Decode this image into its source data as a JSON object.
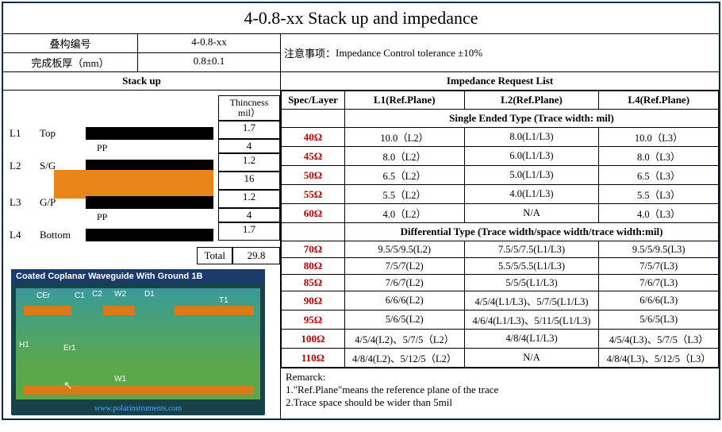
{
  "title": "4-0.8-xx Stack up and impedance",
  "meta": {
    "label1": "叠构编号",
    "val1": "4-0.8-xx",
    "label2": "完成板厚（mm）",
    "val2": "0.8±0.1",
    "note_label": "注意事项：",
    "note_val": "Impedance Control tolerance ±10%"
  },
  "stackup": {
    "title": "Stack  up",
    "thick_hdr1": "Thincness",
    "thick_hdr2": "mil）",
    "layers": [
      {
        "id": "L1",
        "name": "Top",
        "bar": "black",
        "thick": "1.7"
      },
      {
        "id": "",
        "name": "",
        "bar": "",
        "pp": "PP",
        "thick": "4"
      },
      {
        "id": "L2",
        "name": "S/G",
        "bar": "black",
        "thick": "1.2"
      },
      {
        "id": "",
        "name": "",
        "bar": "orange",
        "thick": "16"
      },
      {
        "id": "L3",
        "name": "G/P",
        "bar": "black",
        "thick": "1.2"
      },
      {
        "id": "",
        "name": "",
        "bar": "",
        "pp": "PP",
        "thick": "4"
      },
      {
        "id": "L4",
        "name": "Bottom",
        "bar": "black",
        "thick": "1.7"
      }
    ],
    "total_label": "Total",
    "total_val": "29.8"
  },
  "diagram": {
    "title": "Coated Coplanar Waveguide With Ground 1B",
    "labels": {
      "cer": "CEr",
      "c1": "C1",
      "c2": "C2",
      "w2": "W2",
      "d1": "D1",
      "t1": "T1",
      "er1": "Er1",
      "h1": "H1",
      "w1": "W1"
    },
    "url": "www.polarinstruments.com"
  },
  "impedance": {
    "title": "Impedance Request List",
    "cols": {
      "spec": "Spec/Layer",
      "l1": "L1(Ref.Plane)",
      "l2": "L2(Ref.Plane)",
      "l4": "L4(Ref.Plane)"
    },
    "single_hdr": "Single Ended Type (Trace width:   mil)",
    "single": [
      {
        "spec": "40Ω",
        "l1": "10.0（L2）",
        "l2": "8.0(L1/L3)",
        "l4": "10.0（L3）"
      },
      {
        "spec": "45Ω",
        "l1": "8.0（L2）",
        "l2": "6.0(L1/L3)",
        "l4": "8.0（L3）"
      },
      {
        "spec": "50Ω",
        "l1": "6.5（L2）",
        "l2": "5.0(L1/L3)",
        "l4": "6.5（L3）"
      },
      {
        "spec": "55Ω",
        "l1": "5.5（L2）",
        "l2": "4.0(L1/L3)",
        "l4": "5.5（L3）"
      },
      {
        "spec": "60Ω",
        "l1": "4.0（L2）",
        "l2": "N/A",
        "l4": "4.0（L3）"
      }
    ],
    "diff_hdr": "Differential Type (Trace width/space width/trace width:mil)",
    "diff": [
      {
        "spec": "70Ω",
        "l1": "9.5/5/9.5(L2)",
        "l2": "7.5/5/7.5(L1/L3)",
        "l4": "9.5/5/9.5(L3)"
      },
      {
        "spec": "80Ω",
        "l1": "7/5/7(L2)",
        "l2": "5.5/5/5.5(L1/L3)",
        "l4": "7/5/7(L3)"
      },
      {
        "spec": "85Ω",
        "l1": "7/6/7(L2)",
        "l2": "5/5/5(L1/L3)",
        "l4": "7/6/7(L3)"
      },
      {
        "spec": "90Ω",
        "l1": "6/6/6(L2)",
        "l2": "4/5/4(L1/L3)、5/7/5(L1/L3)",
        "l4": "6/6/6(L3)"
      },
      {
        "spec": "95Ω",
        "l1": "5/6/5(L2)",
        "l2": "4/6/4(L1/L3)、5/11/5(L1/L3)",
        "l4": "5/6/5(L3)"
      },
      {
        "spec": "100Ω",
        "l1": "4/5/4(L2)、5/7/5（L2）",
        "l2": "4/8/4(L1/L3)",
        "l4": "4/5/4(L3)、5/7/5（L3）"
      },
      {
        "spec": "110Ω",
        "l1": "4/8/4(L2)、5/12/5（L2）",
        "l2": "N/A",
        "l4": "4/8/4(L3)、5/12/5（L3）"
      }
    ]
  },
  "remarks": {
    "title": "Remarck:",
    "r1": "1.\"Ref.Plane\"means the reference plane of the trace",
    "r2": "2.Trace space should be wider than 5mil"
  }
}
